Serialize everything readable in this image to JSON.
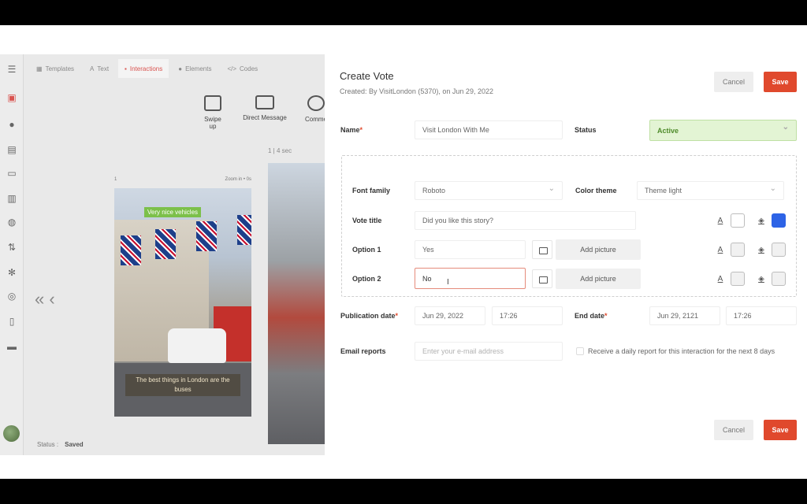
{
  "app": {
    "nav_tabs": [
      {
        "label": "Templates",
        "icon": "grid-icon"
      },
      {
        "label": "Text",
        "icon": "text-icon"
      },
      {
        "label": "Interactions",
        "icon": "interactions-icon"
      },
      {
        "label": "Elements",
        "icon": "elements-icon"
      },
      {
        "label": "Codes",
        "icon": "code-icon"
      }
    ],
    "tools": [
      {
        "label": "Swipe up",
        "icon": "swipe-up-icon"
      },
      {
        "label": "Direct Message",
        "icon": "mail-icon"
      },
      {
        "label": "Comme",
        "icon": "comment-icon"
      }
    ],
    "timer": "1 | 4 sec",
    "phone_header_left": "1",
    "phone_header_right": "Zoom in • 0s",
    "story_label_top": "Very nice vehicles",
    "story_label_bottom": "The best things in London are the buses",
    "status_label": "Status :",
    "status_value": "Saved"
  },
  "modal": {
    "title": "Create Vote",
    "subtitle": "Created:  By VisitLondon (5370), on Jun 29, 2022",
    "cancel_label": "Cancel",
    "save_label": "Save",
    "name_label": "Name",
    "name_value": "Visit London With Me",
    "status_label": "Status",
    "status_value": "Active",
    "font_family_label": "Font family",
    "font_family_value": "Roboto",
    "color_theme_label": "Color theme",
    "color_theme_value": "Theme light",
    "vote_title_label": "Vote title",
    "vote_title_value": "Did you like this story?",
    "option1_label": "Option 1",
    "option1_value": "Yes",
    "option2_label": "Option 2",
    "option2_value": "No",
    "add_picture_label": "Add picture",
    "publication_date_label": "Publication date",
    "publication_date": "Jun 29, 2022",
    "publication_time": "17:26",
    "end_date_label": "End date",
    "end_date": "Jun 29, 2121",
    "end_time": "17:26",
    "email_reports_label": "Email reports",
    "email_placeholder": "Enter your e-mail address",
    "daily_report_label": "Receive a daily report for this interaction for the next 8 days",
    "colors": {
      "save": "#e0492d",
      "active_bg": "#e3f4d4",
      "vote_title_bg_swatch": "#2d63e6"
    }
  }
}
